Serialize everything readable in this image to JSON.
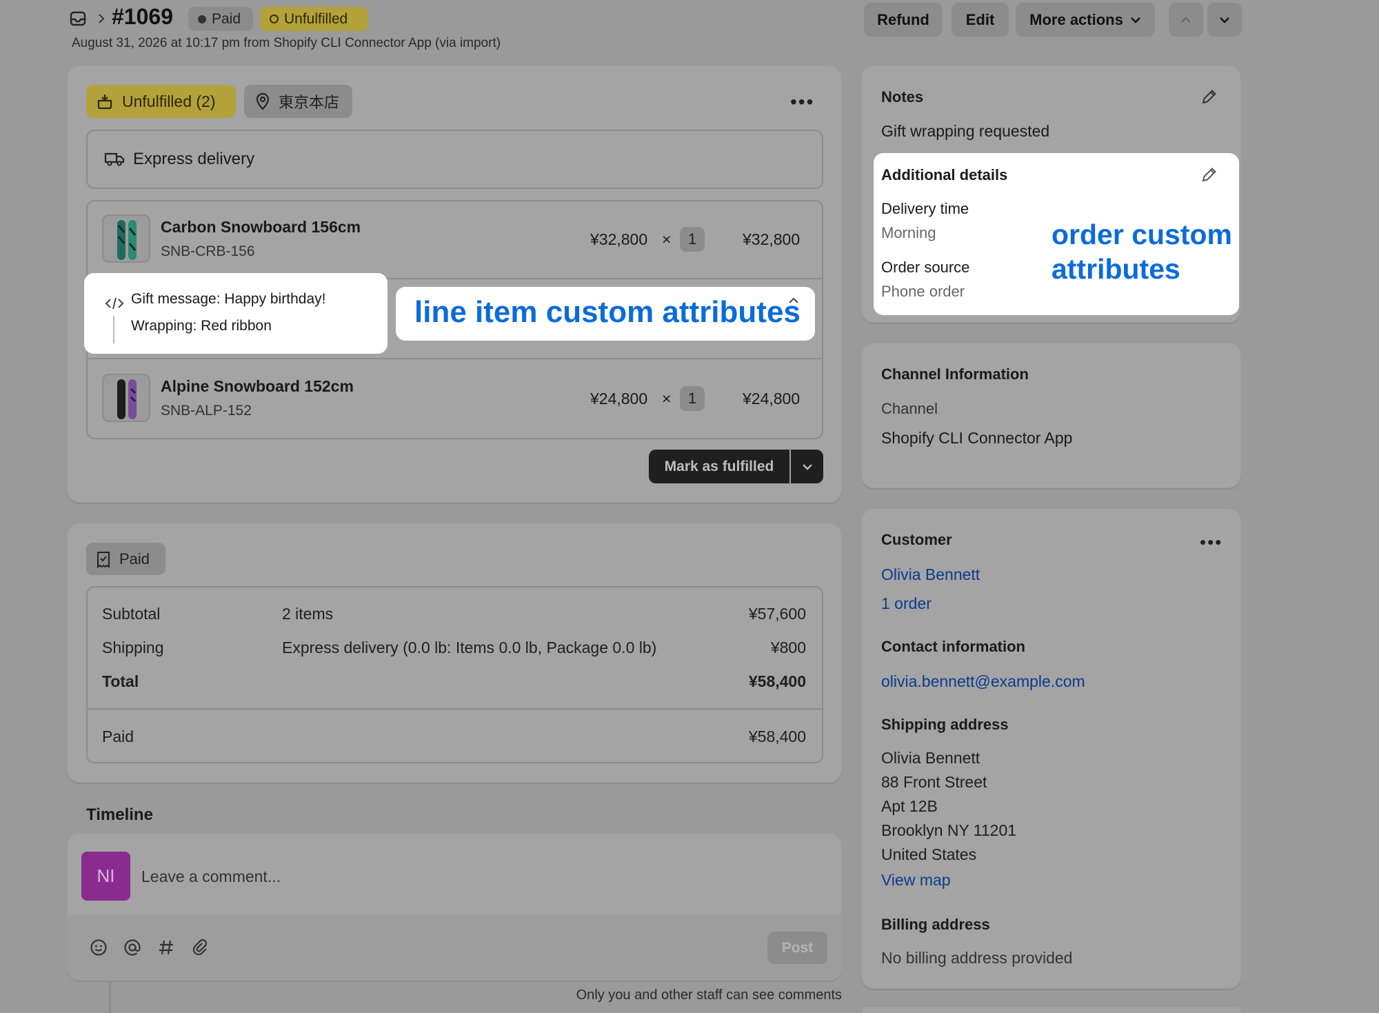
{
  "header": {
    "order_number": "#1069",
    "badge_paid": "Paid",
    "badge_unfulfilled": "Unfulfilled",
    "subtitle": "August 31, 2026 at 10:17 pm from Shopify CLI Connector App (via import)",
    "refund_label": "Refund",
    "edit_label": "Edit",
    "more_actions_label": "More actions"
  },
  "fulfillment": {
    "status_label": "Unfulfilled (2)",
    "location_label": "東京本店",
    "delivery_method": "Express delivery",
    "items": [
      {
        "name": "Carbon Snowboard 156cm",
        "sku": "SNB-CRB-156",
        "price": "¥32,800",
        "times": "×",
        "qty": "1",
        "total": "¥32,800"
      },
      {
        "name": "Alpine Snowboard 152cm",
        "sku": "SNB-ALP-152",
        "price": "¥24,800",
        "times": "×",
        "qty": "1",
        "total": "¥24,800"
      }
    ],
    "line_attributes": [
      "Gift message: Happy birthday!",
      "Wrapping: Red ribbon"
    ],
    "line_callout": "line item custom attributes",
    "mark_fulfilled_label": "Mark as fulfilled"
  },
  "payment": {
    "badge": "Paid",
    "rows": [
      {
        "label": "Subtotal",
        "desc": "2 items",
        "amount": "¥57,600"
      },
      {
        "label": "Shipping",
        "desc": "Express delivery (0.0 lb: Items 0.0 lb, Package 0.0 lb)",
        "amount": "¥800"
      },
      {
        "label": "Total",
        "desc": "",
        "amount": "¥58,400"
      }
    ],
    "paid_label": "Paid",
    "paid_amount": "¥58,400"
  },
  "timeline": {
    "title": "Timeline",
    "avatar_initials": "NI",
    "comment_placeholder": "Leave a comment...",
    "post_label": "Post",
    "staff_note": "Only you and other staff can see comments"
  },
  "notes": {
    "title": "Notes",
    "text": "Gift wrapping requested",
    "additional_title": "Additional details",
    "attrs": [
      {
        "label": "Delivery time",
        "value": "Morning"
      },
      {
        "label": "Order source",
        "value": "Phone order"
      }
    ],
    "order_callout_line1": "order custom",
    "order_callout_line2": "attributes"
  },
  "channel": {
    "title": "Channel Information",
    "label": "Channel",
    "value": "Shopify CLI Connector App"
  },
  "customer": {
    "title": "Customer",
    "name": "Olivia Bennett",
    "orders": "1 order",
    "contact_title": "Contact information",
    "email": "olivia.bennett@example.com",
    "shipping_title": "Shipping address",
    "address_lines": [
      "Olivia Bennett",
      "88 Front Street",
      "Apt 12B",
      "Brooklyn NY 11201",
      "United States"
    ],
    "view_map": "View map",
    "billing_title": "Billing address",
    "billing_text": "No billing address provided"
  },
  "colors": {
    "page_background": "#9a9a9a",
    "callout_text": "#0b6bdb",
    "link": "#0b3b8c",
    "unfulfilled_badge": "#b3a13c",
    "avatar": "#8a2c8f"
  }
}
